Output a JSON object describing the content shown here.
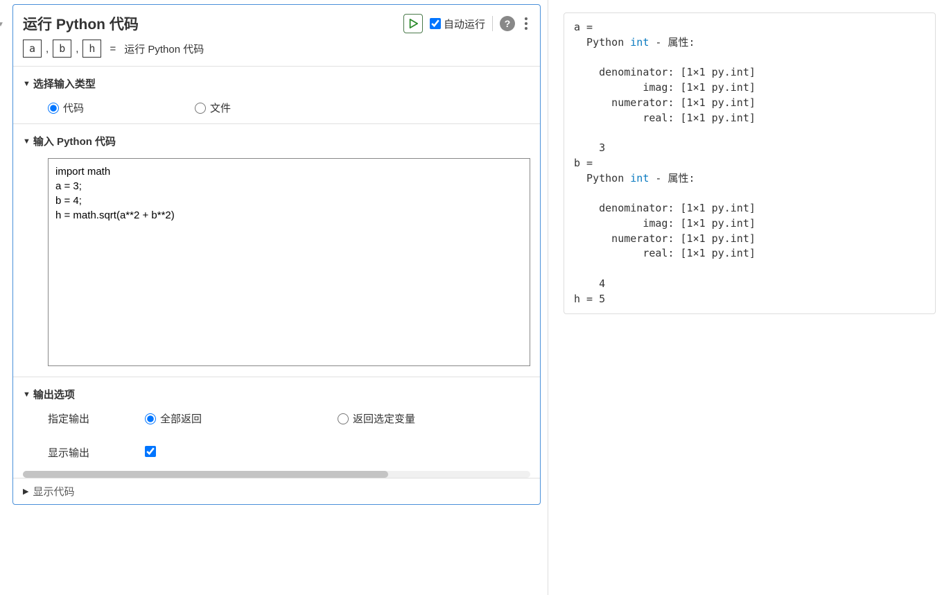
{
  "task": {
    "title": "运行 Python 代码",
    "autorun_label": "自动运行",
    "autorun_checked": true,
    "vars": [
      "a",
      "b",
      "h"
    ],
    "vars_sep": ",",
    "assign_eq": "=",
    "assign_desc": "运行 Python 代码"
  },
  "input_type_section": {
    "header": "选择输入类型",
    "options": {
      "code": "代码",
      "file": "文件"
    },
    "selected": "code"
  },
  "code_section": {
    "header": "输入 Python 代码",
    "value": "import math\na = 3;\nb = 4;\nh = math.sqrt(a**2 + b**2)"
  },
  "output_section": {
    "header": "输出选项",
    "specify_label": "指定输出",
    "specify_options": {
      "all": "全部返回",
      "selected": "返回选定变量"
    },
    "specify_selected": "all",
    "show_label": "显示输出",
    "show_checked": true
  },
  "show_code_label": "显示代码",
  "output": {
    "a": {
      "header": "a = ",
      "type_prefix": "  Python ",
      "type_keyword": "int",
      "type_suffix": " - 属性:",
      "props": [
        "    denominator: [1×1 py.int]",
        "           imag: [1×1 py.int]",
        "      numerator: [1×1 py.int]",
        "           real: [1×1 py.int]"
      ],
      "value": "    3"
    },
    "b": {
      "header": "b = ",
      "type_prefix": "  Python ",
      "type_keyword": "int",
      "type_suffix": " - 属性:",
      "props": [
        "    denominator: [1×1 py.int]",
        "           imag: [1×1 py.int]",
        "      numerator: [1×1 py.int]",
        "           real: [1×1 py.int]"
      ],
      "value": "    4"
    },
    "h": "h = 5"
  }
}
